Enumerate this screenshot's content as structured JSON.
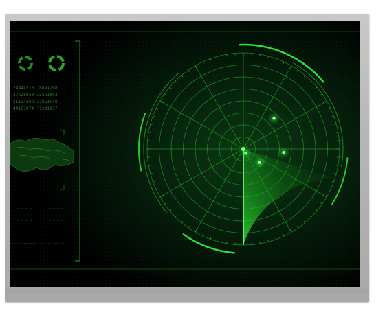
{
  "colors": {
    "background": "#000000",
    "radar_green": "#1dbf28",
    "glow_green": "#39ff3a",
    "dim_green": "#0f4a12",
    "bezel_silver": "#b9b9b9"
  },
  "left_panel": {
    "data_rows": [
      [
        "24444213",
        "78897298"
      ],
      [
        "37526840",
        "32421893"
      ],
      [
        "21124609",
        "21861940"
      ],
      [
        "44187074",
        "71241937"
      ]
    ],
    "small_labels": [
      "— — — —",
      "— — — —",
      "— — — —",
      "— — — —"
    ]
  },
  "radar": {
    "sweep_angle_start_deg": 90,
    "sweep_angle_end_deg": 162,
    "rings": 8,
    "spokes": 12,
    "blips": [
      {
        "name": "blip-1",
        "r": 0.45,
        "angle_deg": -45
      },
      {
        "name": "blip-2",
        "r": 0.42,
        "angle_deg": 5
      },
      {
        "name": "blip-3",
        "r": 0.22,
        "angle_deg": 40
      },
      {
        "name": "blip-4",
        "r": 0.05,
        "angle_deg": 60
      }
    ]
  }
}
